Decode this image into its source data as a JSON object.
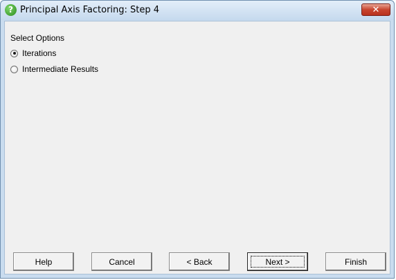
{
  "window": {
    "title": "Principal Axis Factoring: Step 4",
    "title_icon": "help-question-icon",
    "close_glyph": "✕"
  },
  "options": {
    "heading": "Select Options",
    "items": [
      {
        "label": "Iterations",
        "checked": true
      },
      {
        "label": "Intermediate Results",
        "checked": false
      }
    ]
  },
  "buttons": {
    "help": "Help",
    "cancel": "Cancel",
    "back": "< Back",
    "next": "Next >",
    "finish": "Finish"
  },
  "colors": {
    "titlebar": "#c5d9ee",
    "close": "#c8452f",
    "client": "#f0f0f0"
  }
}
